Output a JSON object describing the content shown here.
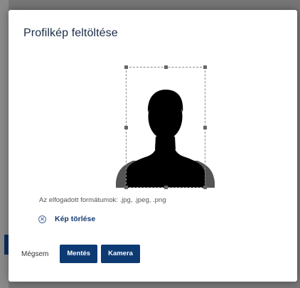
{
  "dialog": {
    "title": "Profilkép feltöltése"
  },
  "image": {
    "icon": "person-silhouette-icon"
  },
  "formats_text": "Az elfogadott formátumok: .jpg, .jpeg, .png",
  "delete": {
    "icon": "close-circle-icon",
    "label": "Kép törlése"
  },
  "footer": {
    "cancel_label": "Mégsem",
    "save_label": "Mentés",
    "camera_label": "Kamera"
  },
  "colors": {
    "primary": "#0d3a73",
    "link": "#163a73",
    "title": "#1a2b45"
  }
}
